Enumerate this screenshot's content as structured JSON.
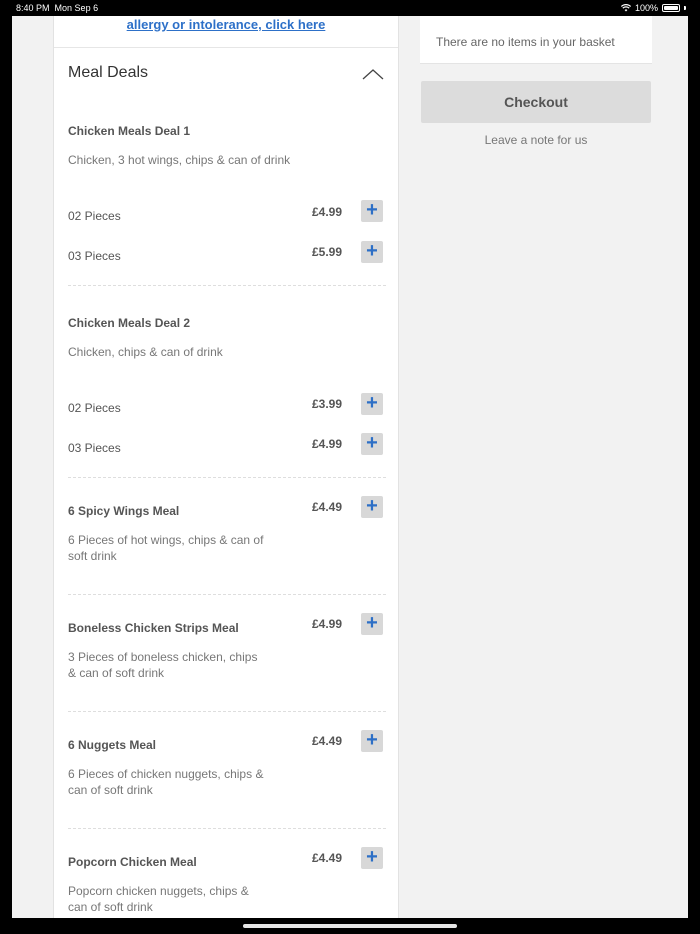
{
  "status_bar": {
    "time": "8:40 PM",
    "date": "Mon Sep 6",
    "battery": "100%"
  },
  "allergy_link": "allergy or intolerance, click here",
  "section": {
    "title": "Meal Deals"
  },
  "deals": [
    {
      "title": "Chicken Meals Deal 1",
      "description": "Chicken, 3 hot wings, chips & can of drink",
      "options": [
        {
          "label": "02 Pieces",
          "price": "£4.99"
        },
        {
          "label": "03 Pieces",
          "price": "£5.99"
        }
      ]
    },
    {
      "title": "Chicken Meals Deal 2",
      "description": "Chicken, chips & can of drink",
      "options": [
        {
          "label": "02 Pieces",
          "price": "£3.99"
        },
        {
          "label": "03 Pieces",
          "price": "£4.99"
        }
      ]
    }
  ],
  "meals": [
    {
      "title": "6 Spicy Wings Meal",
      "description": "6 Pieces of hot wings, chips & can of soft drink",
      "price": "£4.49"
    },
    {
      "title": "Boneless Chicken Strips Meal",
      "description": "3 Pieces of boneless chicken, chips & can of soft drink",
      "price": "£4.99"
    },
    {
      "title": "6 Nuggets Meal",
      "description": "6 Pieces of chicken nuggets, chips & can of soft drink",
      "price": "£4.49"
    },
    {
      "title": "Popcorn Chicken Meal",
      "description": "Popcorn chicken nuggets, chips & can of soft drink",
      "price": "£4.49"
    }
  ],
  "add_symbol": "+",
  "basket": {
    "empty_text": "There are no items in your basket",
    "checkout_label": "Checkout",
    "note_label": "Leave a note for us"
  },
  "colors": {
    "accent": "#2d70c8",
    "button_bg": "#d8d8d8",
    "page_bg": "#f2f2f2"
  }
}
